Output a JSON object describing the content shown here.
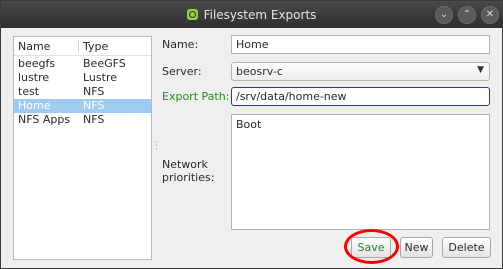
{
  "window": {
    "title": "Filesystem Exports",
    "controls": {
      "minimize": "⌄",
      "maximize": "⌃",
      "close": "✕"
    }
  },
  "list": {
    "columns": [
      "Name",
      "Type"
    ],
    "rows": [
      {
        "name": "beegfs",
        "type": "BeeGFS"
      },
      {
        "name": "lustre",
        "type": "Lustre"
      },
      {
        "name": "test",
        "type": "NFS"
      },
      {
        "name": "Home",
        "type": "NFS",
        "selected": true
      },
      {
        "name": "NFS Apps",
        "type": "NFS"
      }
    ]
  },
  "form": {
    "name_label": "Name:",
    "name_value": "Home",
    "server_label": "Server:",
    "server_value": "beosrv-c",
    "export_path_label": "Export Path:",
    "export_path_value": "/srv/data/home-new",
    "network_label": "Network priorities:",
    "network_value": "Boot"
  },
  "buttons": {
    "save": "Save",
    "new": "New",
    "delete": "Delete"
  },
  "colors": {
    "accent_green": "#1f8a1f",
    "selection": "#9fcbf0",
    "highlight_ring": "#ff0000"
  }
}
